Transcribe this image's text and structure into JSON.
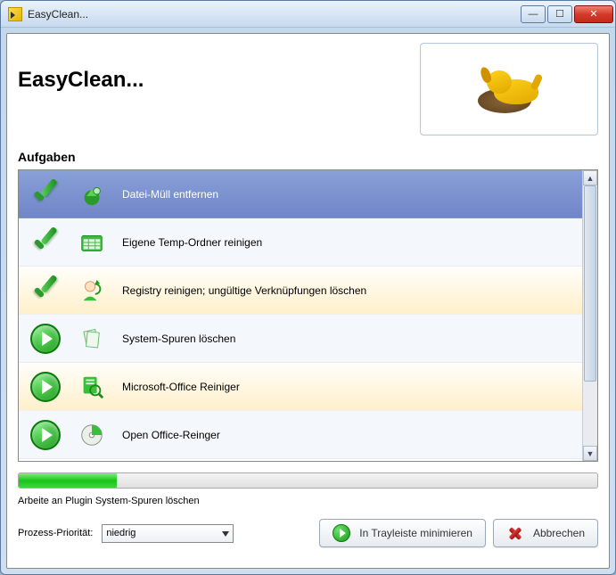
{
  "window": {
    "title": "EasyClean..."
  },
  "header": {
    "app_title": "EasyClean..."
  },
  "section": {
    "tasks_title": "Aufgaben"
  },
  "tasks": [
    {
      "status": "done",
      "icon": "recycle-icon",
      "label": "Datei-Müll entfernen",
      "selected": true
    },
    {
      "status": "done",
      "icon": "calendar-icon",
      "label": "Eigene Temp-Ordner reinigen",
      "selected": false
    },
    {
      "status": "done",
      "icon": "user-refresh-icon",
      "label": "Registry reinigen; ungültige Verknüpfungen löschen",
      "selected": false
    },
    {
      "status": "pending",
      "icon": "papers-icon",
      "label": "System-Spuren löschen",
      "selected": false
    },
    {
      "status": "pending",
      "icon": "office-search-icon",
      "label": "Microsoft-Office Reiniger",
      "selected": false
    },
    {
      "status": "pending",
      "icon": "disc-icon",
      "label": "Open Office-Reinger",
      "selected": false
    }
  ],
  "progress": {
    "percent": 17
  },
  "status": {
    "text": "Arbeite an Plugin System-Spuren löschen"
  },
  "priority": {
    "label": "Prozess-Priorität:",
    "value": "niedrig"
  },
  "buttons": {
    "minimize": "In Trayleiste minimieren",
    "cancel": "Abbrechen"
  }
}
